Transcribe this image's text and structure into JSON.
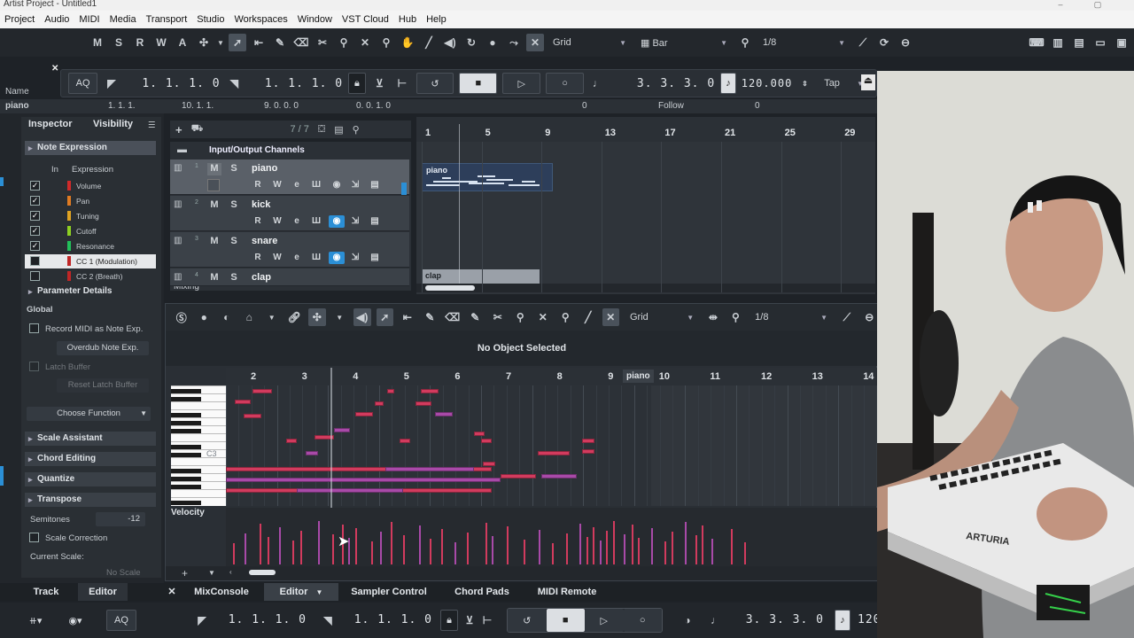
{
  "window": {
    "title": "Artist Project - Untitled1"
  },
  "menu": [
    "Project",
    "Audio",
    "MIDI",
    "Media",
    "Transport",
    "Studio",
    "Workspaces",
    "Window",
    "VST Cloud",
    "Hub",
    "Help"
  ],
  "toolbar": {
    "mode_buttons": [
      "M",
      "S",
      "R",
      "W",
      "A"
    ],
    "snap_type": "Grid",
    "grid_type": "Bar",
    "quantize": "1/8"
  },
  "transport": {
    "aq": "AQ",
    "left_locator": "1. 1. 1.   0",
    "right_locator": "1. 1. 1.   0",
    "position": "3. 3. 3.   0",
    "tempo": "120.000",
    "tap": "Tap"
  },
  "ruler_info": {
    "name_label": "Name",
    "track_name": "piano",
    "vals": [
      "1. 1. 1.",
      "10. 1. 1.",
      "9. 0. 0. 0",
      "0. 0. 1. 0",
      "0",
      "Follow",
      "0"
    ]
  },
  "inspector": {
    "tabs": [
      "Inspector",
      "Visibility"
    ],
    "note_expression": {
      "title": "Note Expression",
      "col_in": "In",
      "col_expression": "Expression",
      "rows": [
        {
          "label": "Volume",
          "checked": true,
          "color": "#d02a2a"
        },
        {
          "label": "Pan",
          "checked": true,
          "color": "#e07b22"
        },
        {
          "label": "Tuning",
          "checked": true,
          "color": "#e0a322"
        },
        {
          "label": "Cutoff",
          "checked": true,
          "color": "#8ed022"
        },
        {
          "label": "Resonance",
          "checked": true,
          "color": "#22c05a"
        },
        {
          "label": "CC 1 (Modulation)",
          "checked": false,
          "color": "#c02626"
        },
        {
          "label": "CC 2 (Breath)",
          "checked": false,
          "color": "#c02626"
        }
      ]
    },
    "parameter_details": "Parameter Details",
    "global": "Global",
    "record_midi": "Record MIDI as Note Exp.",
    "overdub": "Overdub Note Exp.",
    "latch_buffer": "Latch Buffer",
    "reset_latch": "Reset Latch Buffer",
    "choose_function": "Choose Function",
    "sections": [
      "Scale Assistant",
      "Chord Editing",
      "Quantize",
      "Transpose"
    ],
    "semitones_label": "Semitones",
    "semitones_value": "-12",
    "scale_correction": "Scale Correction",
    "current_scale": "Current Scale:",
    "no_scale": "No Scale"
  },
  "tracklist": {
    "count": "7 / 7",
    "folder": "Input/Output Channels",
    "mixing": "Mixing",
    "tracks": [
      {
        "num": "1",
        "name": "piano",
        "selected": true
      },
      {
        "num": "2",
        "name": "kick",
        "selected": false
      },
      {
        "num": "3",
        "name": "snare",
        "selected": false
      },
      {
        "num": "4",
        "name": "clap",
        "selected": false
      }
    ],
    "track_buttons": [
      "R",
      "W"
    ]
  },
  "arrange": {
    "bars": [
      "1",
      "5",
      "9",
      "13",
      "17",
      "21",
      "25",
      "29"
    ],
    "parts": [
      {
        "name": "piano"
      },
      {
        "name": "clap"
      }
    ]
  },
  "editor": {
    "snap_type": "Grid",
    "quantize": "1/8",
    "status": "No Object Selected",
    "bars": [
      "2",
      "3",
      "4",
      "5",
      "6",
      "7",
      "8",
      "9",
      "10",
      "11",
      "12",
      "13",
      "14"
    ],
    "part_label": "piano",
    "key_label": "C3",
    "velocity_label": "Velocity"
  },
  "bottom_tabs": [
    "Track",
    "Editor",
    "MixConsole",
    "Editor",
    "Sampler Control",
    "Chord Pads",
    "MIDI Remote"
  ],
  "bottom_transport": {
    "aq": "AQ",
    "left_locator": "1. 1. 1.   0",
    "right_locator": "1. 1. 1.   0",
    "position": "3. 3. 3.   0",
    "tempo_partial": "120"
  },
  "webcam": {
    "brand": "ARTURIA"
  }
}
